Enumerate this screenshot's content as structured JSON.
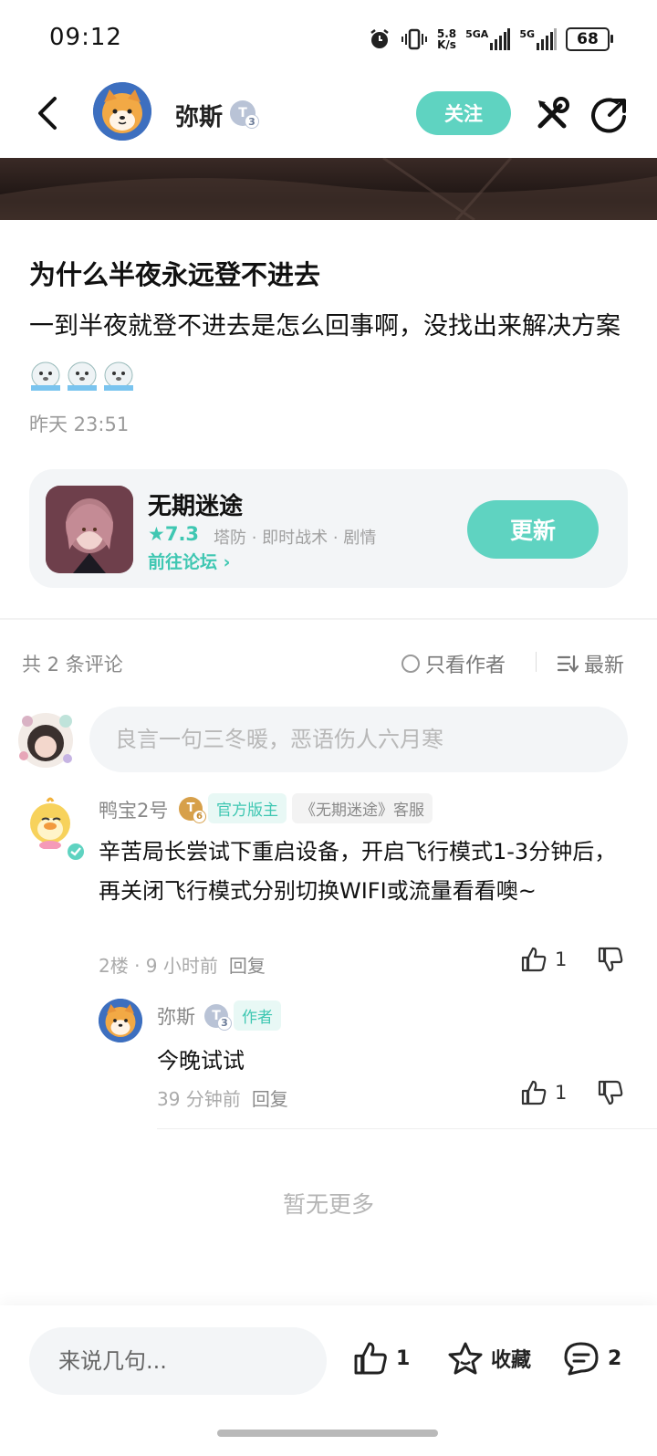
{
  "status_bar": {
    "time": "09:12",
    "net_speed_top": "5.8",
    "net_speed_bottom": "K/s",
    "sig1_label": "5GA",
    "sig2_label": "5G",
    "battery": "68"
  },
  "header": {
    "username": "弥斯",
    "level": "T",
    "level_num": "3",
    "follow_label": "关注"
  },
  "post": {
    "title": "为什么半夜永远登不进去",
    "body": "一到半夜就登不进去是怎么回事啊，没找出来解决方案",
    "time": "昨天 23:51"
  },
  "game": {
    "name": "无期迷途",
    "rating": "★7.3",
    "tags": "塔防 · 即时战术 · 剧情",
    "forum_link": "前往论坛",
    "update_label": "更新"
  },
  "comments_header": {
    "count": "共 2 条评论",
    "only_author": "只看作者",
    "sort": "最新"
  },
  "comment_input": {
    "placeholder": "良言一句三冬暖，恶语伤人六月寒"
  },
  "comments": [
    {
      "name": "鸭宝2号",
      "level": "T",
      "level_num": "6",
      "tag_official": "官方版主",
      "tag_role": "《无期迷途》客服",
      "text": "辛苦局长尝试下重启设备，开启飞行模式1-3分钟后，再关闭飞行模式分别切换WIFI或流量看看噢~",
      "floor": "2楼 · 9 小时前",
      "reply": "回复",
      "likes": "1",
      "replies": [
        {
          "name": "弥斯",
          "level": "T",
          "level_num": "3",
          "tag_author": "作者",
          "text": "今晚试试",
          "time": "39 分钟前",
          "reply": "回复",
          "likes": "1"
        }
      ]
    }
  ],
  "no_more": "暂无更多",
  "bottom_bar": {
    "placeholder": "来说几句...",
    "likes": "1",
    "favorite": "收藏",
    "comments": "2"
  },
  "colors": {
    "accent": "#5fd3c1",
    "accent_text": "#3fc7b2",
    "muted": "#9a9a9a"
  }
}
